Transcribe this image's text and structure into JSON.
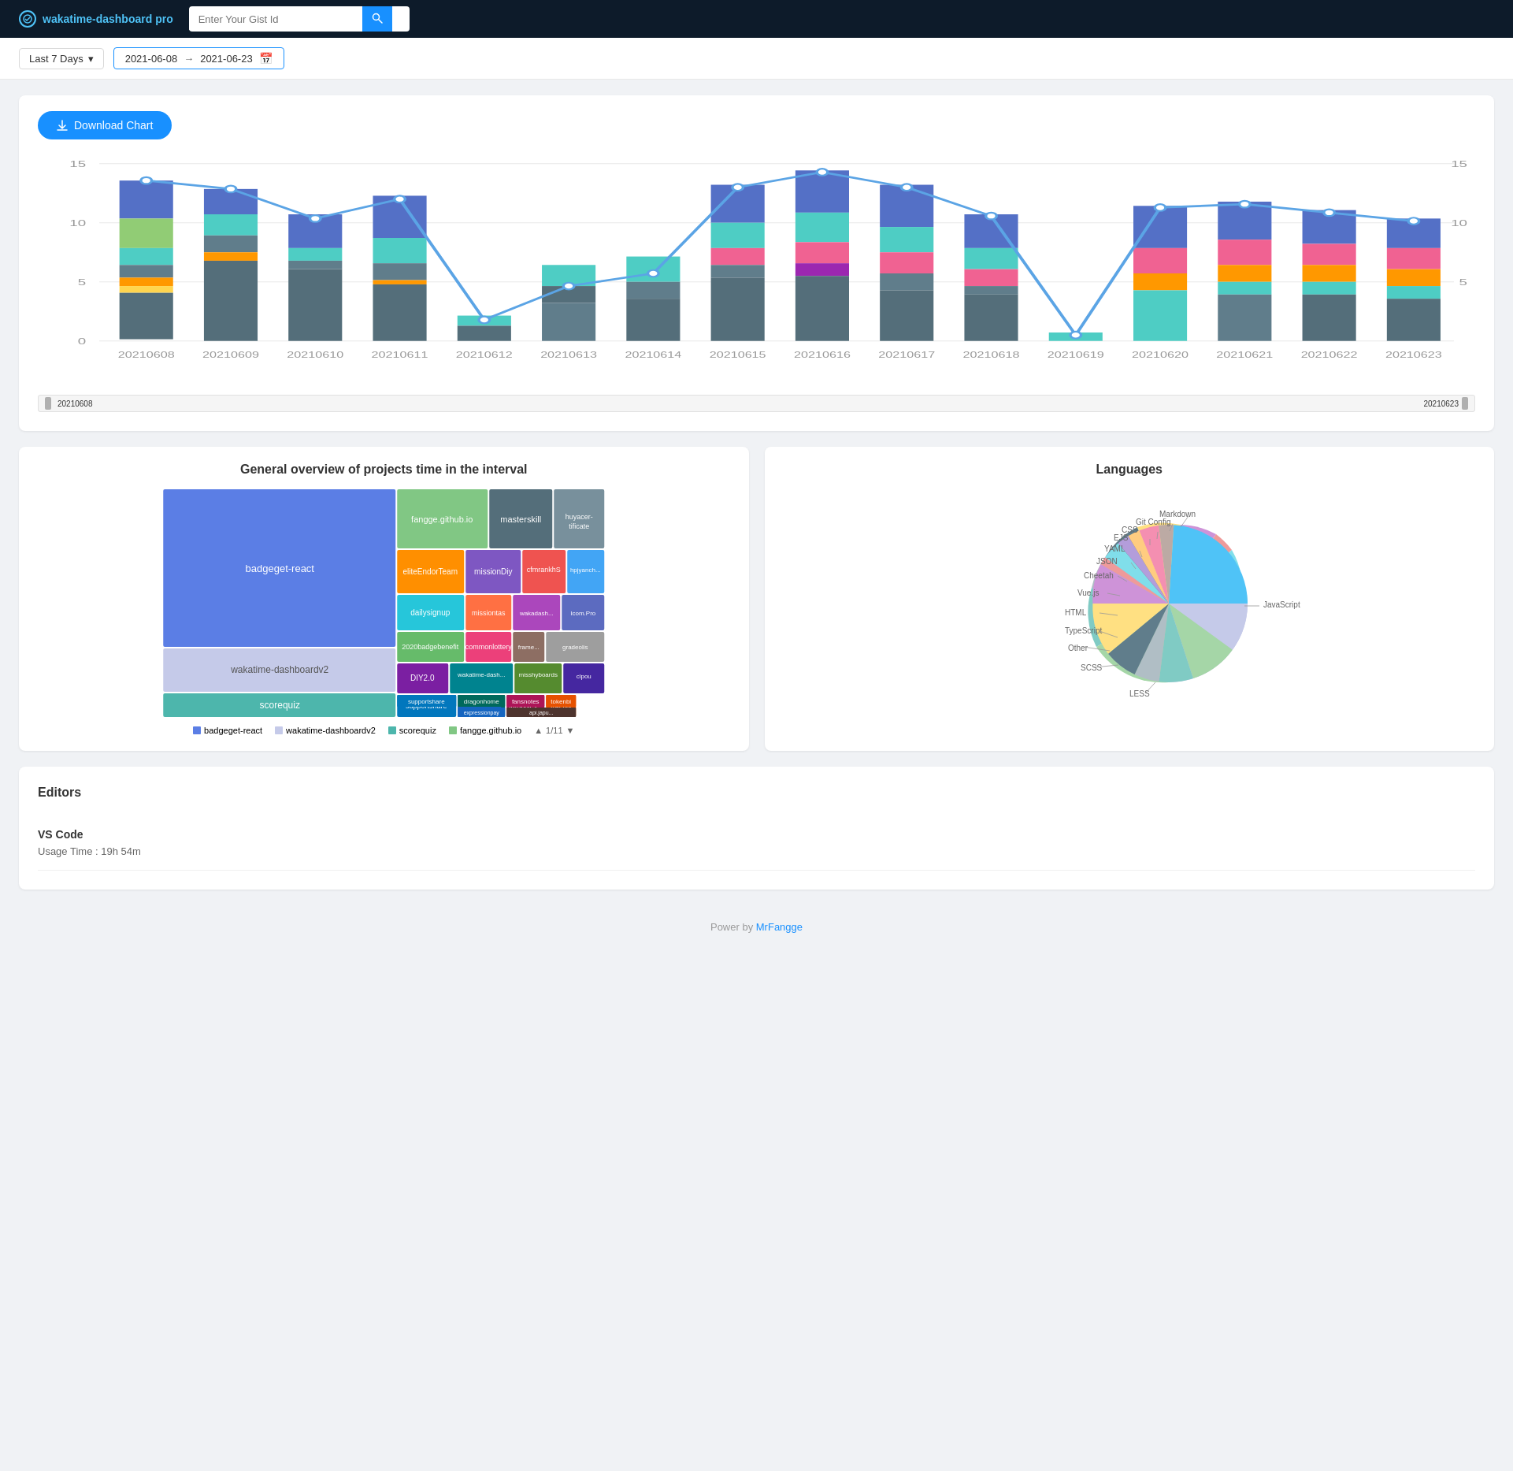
{
  "header": {
    "logo_text": "wakatime-dashboard pro",
    "search_placeholder": "Enter Your Gist Id",
    "search_btn_icon": "🔍"
  },
  "datebar": {
    "preset_label": "Last 7 Days",
    "start_date": "2021-06-08",
    "end_date": "2021-06-23",
    "arrow": "→"
  },
  "chart": {
    "download_btn": "Download Chart",
    "y_labels": [
      "0",
      "5",
      "10",
      "15"
    ],
    "x_labels": [
      "20210608",
      "20210609",
      "20210610",
      "20210611",
      "20210612",
      "20210613",
      "20210614",
      "20210615",
      "20210616",
      "20210617",
      "20210618",
      "20210619",
      "20210620",
      "20210621",
      "20210622",
      "20210623"
    ],
    "slider_left": "20210608",
    "slider_right": "20210623"
  },
  "projects": {
    "title": "General overview of projects time in the interval",
    "legend": [
      {
        "label": "badgeget-react",
        "color": "#5b7ee5"
      },
      {
        "label": "wakatime-dashboardv2",
        "color": "#c5cae9"
      },
      {
        "label": "scorequiz",
        "color": "#4db6ac"
      },
      {
        "label": "fangge.github.io",
        "color": "#81c784"
      }
    ],
    "pagination": "1/11"
  },
  "languages": {
    "title": "Languages",
    "items": [
      {
        "label": "JavaScript",
        "color": "#c5cae9",
        "pct": 28
      },
      {
        "label": "LESS",
        "color": "#a5d6a7",
        "pct": 12
      },
      {
        "label": "SCSS",
        "color": "#80cbc4",
        "pct": 8
      },
      {
        "label": "Other",
        "color": "#b0bec5",
        "pct": 6
      },
      {
        "label": "TypeScript",
        "color": "#607d8b",
        "pct": 7
      },
      {
        "label": "HTML",
        "color": "#ffe082",
        "pct": 8
      },
      {
        "label": "Vue.js",
        "color": "#ce93d8",
        "pct": 6
      },
      {
        "label": "Cheetah",
        "color": "#ef9a9a",
        "pct": 3
      },
      {
        "label": "JSON",
        "color": "#80deea",
        "pct": 4
      },
      {
        "label": "YAML",
        "color": "#b39ddb",
        "pct": 3
      },
      {
        "label": "EJS",
        "color": "#ffcc80",
        "pct": 3
      },
      {
        "label": "CSS",
        "color": "#f48fb1",
        "pct": 4
      },
      {
        "label": "Git Config",
        "color": "#bcaaa4",
        "pct": 3
      },
      {
        "label": "Markdown",
        "color": "#4fc3f7",
        "pct": 5
      }
    ]
  },
  "editors": {
    "title": "Editors",
    "items": [
      {
        "name": "VS Code",
        "usage": "Usage Time : 19h 54m"
      }
    ]
  },
  "footer": {
    "text": "Power by ",
    "link_text": "MrFangge",
    "link_url": "#"
  }
}
